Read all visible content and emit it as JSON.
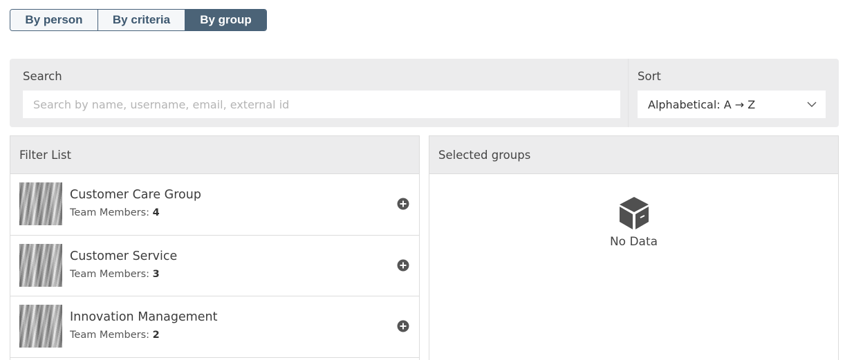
{
  "view_toggle": {
    "options": [
      "By person",
      "By criteria",
      "By group"
    ],
    "selected": "By group"
  },
  "search": {
    "label": "Search",
    "placeholder": "Search by name, username, email, external id",
    "value": ""
  },
  "sort": {
    "label": "Sort",
    "value": "Alphabetical: A → Z"
  },
  "filter_list": {
    "title": "Filter List",
    "member_label": "Team Members:",
    "groups": [
      {
        "name": "Customer Care Group",
        "members": "4"
      },
      {
        "name": "Customer Service",
        "members": "3"
      },
      {
        "name": "Innovation Management",
        "members": "2"
      }
    ]
  },
  "selected_groups": {
    "title": "Selected groups",
    "empty_text": "No Data"
  },
  "icons": {
    "add": "plus-circle-icon",
    "sort_dropdown": "chevron-down-icon",
    "empty": "box-icon"
  },
  "colors": {
    "accent": "#4b6377",
    "panel_bg": "#ececed"
  }
}
